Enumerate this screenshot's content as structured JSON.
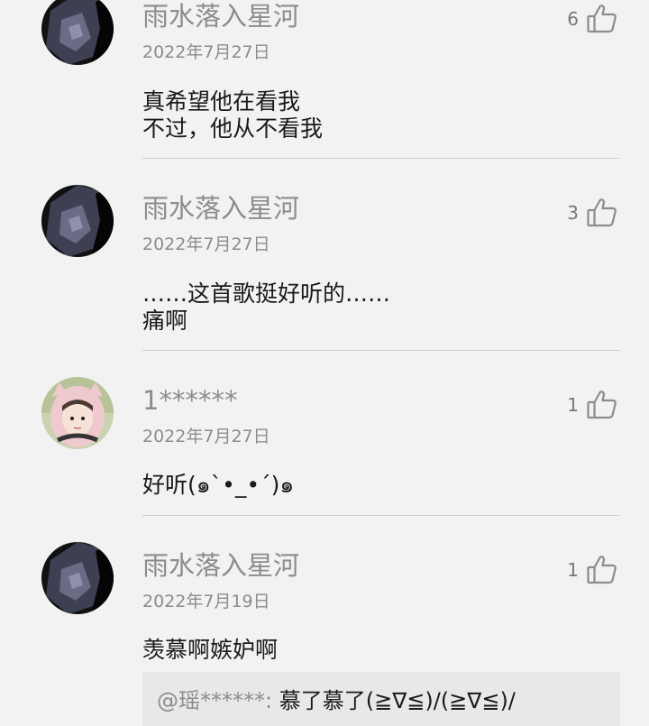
{
  "comments": [
    {
      "username": "雨水落入星河",
      "date": "2022年7月27日",
      "likes": "6",
      "lines": [
        "真希望他在看我",
        "不过，他从不看我"
      ],
      "avatar": "dark-avatar-icon"
    },
    {
      "username": "雨水落入星河",
      "date": "2022年7月27日",
      "likes": "3",
      "lines": [
        "……这首歌挺好听的……",
        "痛啊"
      ],
      "avatar": "dark-avatar-icon"
    },
    {
      "username": "1******",
      "date": "2022年7月27日",
      "likes": "1",
      "lines": [
        "好听(๑`•_•´)๑"
      ],
      "avatar": "person-avatar-icon"
    },
    {
      "username": "雨水落入星河",
      "date": "2022年7月19日",
      "likes": "1",
      "lines": [
        "羡慕啊嫉妒啊"
      ],
      "avatar": "dark-avatar-icon",
      "reply": {
        "author": "@瑶******:",
        "text": " 慕了慕了(≧∇≦)/(≧∇≦)/"
      }
    }
  ],
  "colors": {
    "background": "#f2f2f2",
    "muted_text": "#8c8c8c",
    "body_text": "#1a1a1a",
    "divider": "#cfcfcf"
  },
  "icons": {
    "like": "thumbs-up-icon"
  }
}
